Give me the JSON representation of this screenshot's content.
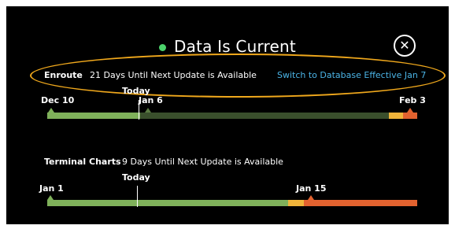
{
  "header": {
    "status_text": "Data Is Current",
    "status_color": "#4cd26b",
    "close_icon": "close-icon"
  },
  "enroute": {
    "label": "Enroute",
    "info": "21 Days Until Next Update is Available",
    "switch_link": "Switch to Database Effective Jan 7",
    "ticks": {
      "start": "Dec 10",
      "today": "Today",
      "mid": "Jan 6",
      "end": "Feb 3"
    },
    "timeline": {
      "elapsed_fraction": 0.25,
      "warning_start_fraction": 0.92,
      "danger_start_fraction": 0.96
    }
  },
  "terminal": {
    "label": "Terminal Charts",
    "info": "9 Days Until Next Update is Available",
    "ticks": {
      "start": "Jan 1",
      "today": "Today",
      "mid": "Jan 15"
    },
    "timeline": {
      "elapsed_fraction": 0.25,
      "warning_start_fraction": 0.65,
      "danger_start_fraction": 0.69
    }
  },
  "colors": {
    "accent": "#f0a81c",
    "link": "#4bb4e6",
    "green": "#7fb15a",
    "dark_green": "#3a4f2c",
    "amber": "#f0b43a",
    "red": "#e2622f"
  }
}
